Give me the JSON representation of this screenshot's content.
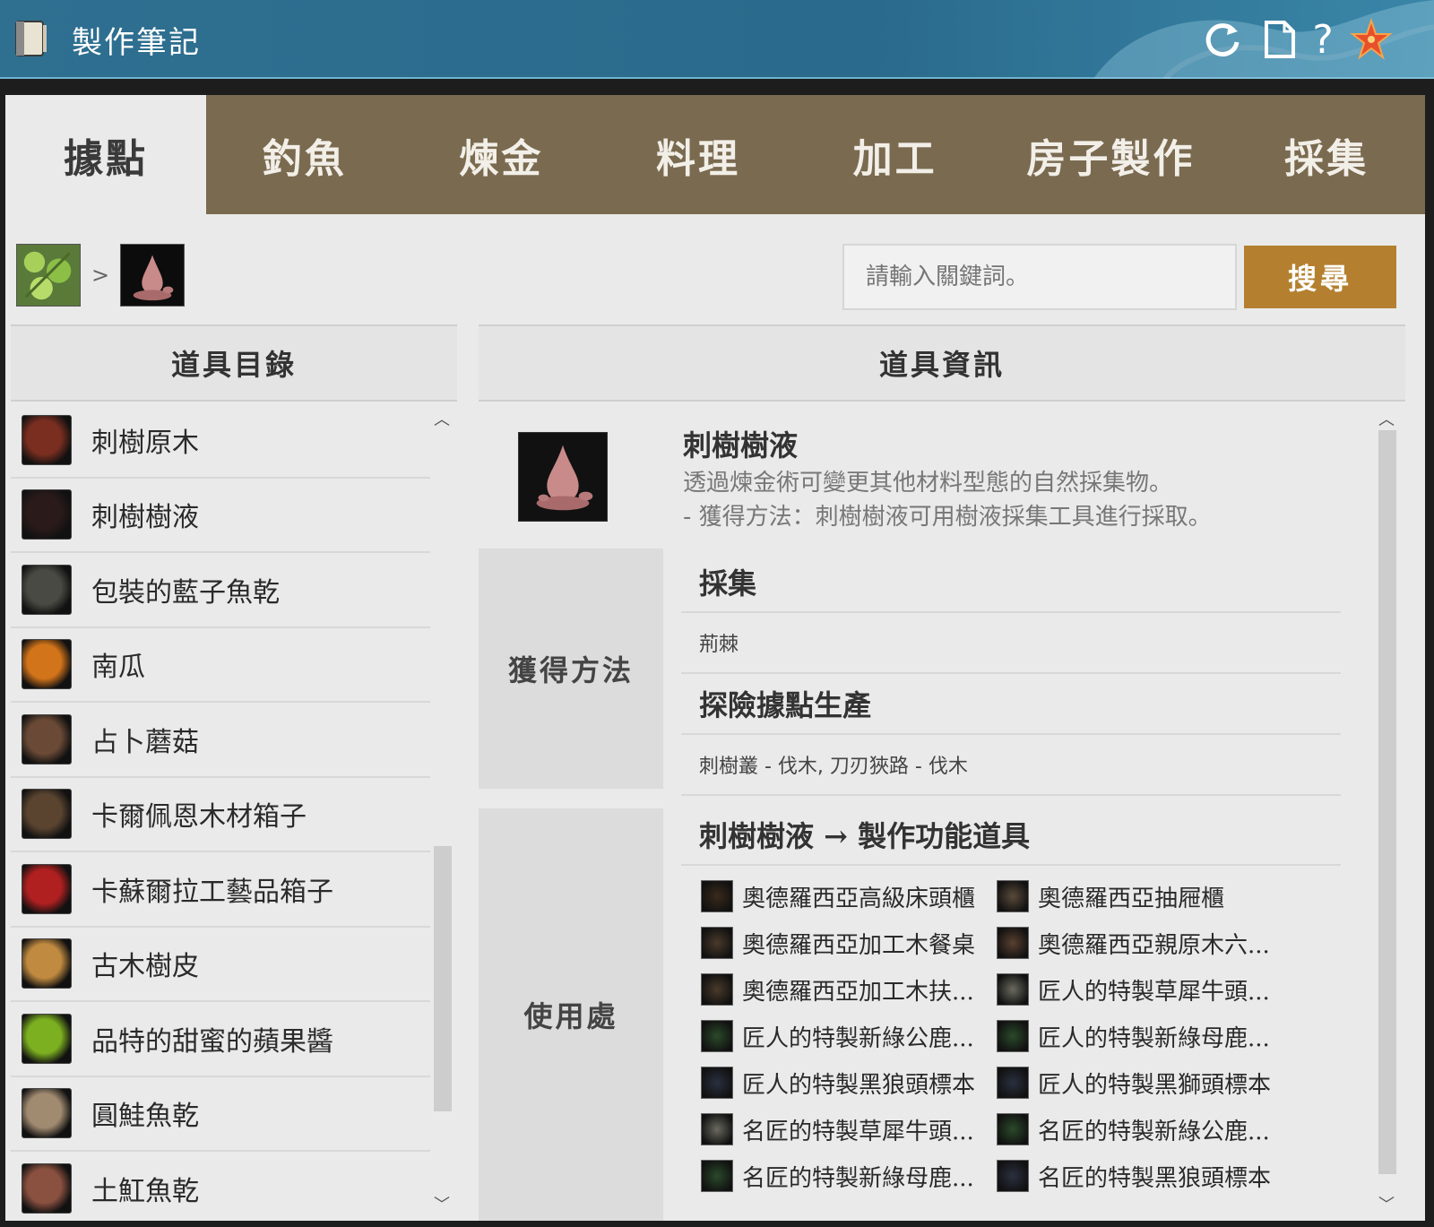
{
  "titlebar": {
    "title": "製作筆記",
    "icons": [
      "book-icon",
      "refresh-icon",
      "page-icon",
      "help-icon",
      "starfish-icon"
    ],
    "help_glyph": "?"
  },
  "tabs": [
    {
      "label": "據點",
      "active": true
    },
    {
      "label": "釣魚",
      "active": false
    },
    {
      "label": "煉金",
      "active": false
    },
    {
      "label": "料理",
      "active": false
    },
    {
      "label": "加工",
      "active": false
    },
    {
      "label": "房子製作",
      "active": false
    },
    {
      "label": "採集",
      "active": false
    }
  ],
  "breadcrumb": {
    "separator": ">",
    "items": [
      "herb-icon",
      "sap-drop-icon"
    ]
  },
  "search": {
    "placeholder": "請輸入關鍵詞。",
    "button_label": "搜尋"
  },
  "left_panel": {
    "title": "道具目錄",
    "items": [
      {
        "label": "刺樹原木",
        "icon": "log-icon",
        "color": "#7a2e20"
      },
      {
        "label": "刺樹樹液",
        "icon": "sap-drop-icon",
        "color": "#2a1a1a"
      },
      {
        "label": "包裝的藍子魚乾",
        "icon": "package-icon",
        "color": "#4a4a44"
      },
      {
        "label": "南瓜",
        "icon": "pumpkin-icon",
        "color": "#d2741a"
      },
      {
        "label": "占卜蘑菇",
        "icon": "mushroom-icon",
        "color": "#6a4a36"
      },
      {
        "label": "卡爾佩恩木材箱子",
        "icon": "crate-icon",
        "color": "#5a4430"
      },
      {
        "label": "卡蘇爾拉工藝品箱子",
        "icon": "red-box-icon",
        "color": "#b02020"
      },
      {
        "label": "古木樹皮",
        "icon": "bark-icon",
        "color": "#c08a40"
      },
      {
        "label": "品特的甜蜜的蘋果醬",
        "icon": "apple-jam-icon",
        "color": "#7cb020"
      },
      {
        "label": "圓鮭魚乾",
        "icon": "dried-fish-icon",
        "color": "#a08a70"
      },
      {
        "label": "土魟魚乾",
        "icon": "dried-ray-icon",
        "color": "#8a5040"
      }
    ]
  },
  "right_panel": {
    "title": "道具資訊",
    "item_name": "刺樹樹液",
    "desc_line1": "透過煉金術可變更其他材料型態的自然採集物。",
    "desc_line2": "- 獲得方法：刺樹樹液可用樹液採集工具進行採取。",
    "obtain": {
      "label": "獲得方法",
      "gather_head": "採集",
      "gather_value": "荊棘",
      "node_head": "探險據點生產",
      "node_value": "刺樹叢 - 伐木, 刀刃狹路 - 伐木"
    },
    "usage": {
      "label": "使用處",
      "head": "刺樹樹液 → 製作功能道具",
      "items": [
        "奧德羅西亞高級床頭櫃",
        "奧德羅西亞抽屜櫃",
        "奧德羅西亞加工木餐桌",
        "奧德羅西亞親原木六...",
        "奧德羅西亞加工木扶...",
        "匠人的特製草犀牛頭...",
        "匠人的特製新綠公鹿...",
        "匠人的特製新綠母鹿...",
        "匠人的特製黑狼頭標本",
        "匠人的特製黑獅頭標本",
        "名匠的特製草犀牛頭...",
        "名匠的特製新綠公鹿...",
        "名匠的特製新綠母鹿...",
        "名匠的特製黑狼頭標本"
      ]
    }
  },
  "colors": {
    "titlebar": "#2a6a8c",
    "tab_bar": "#7a6a50",
    "search_button": "#b48030",
    "panel_bg": "#eaeaea"
  }
}
